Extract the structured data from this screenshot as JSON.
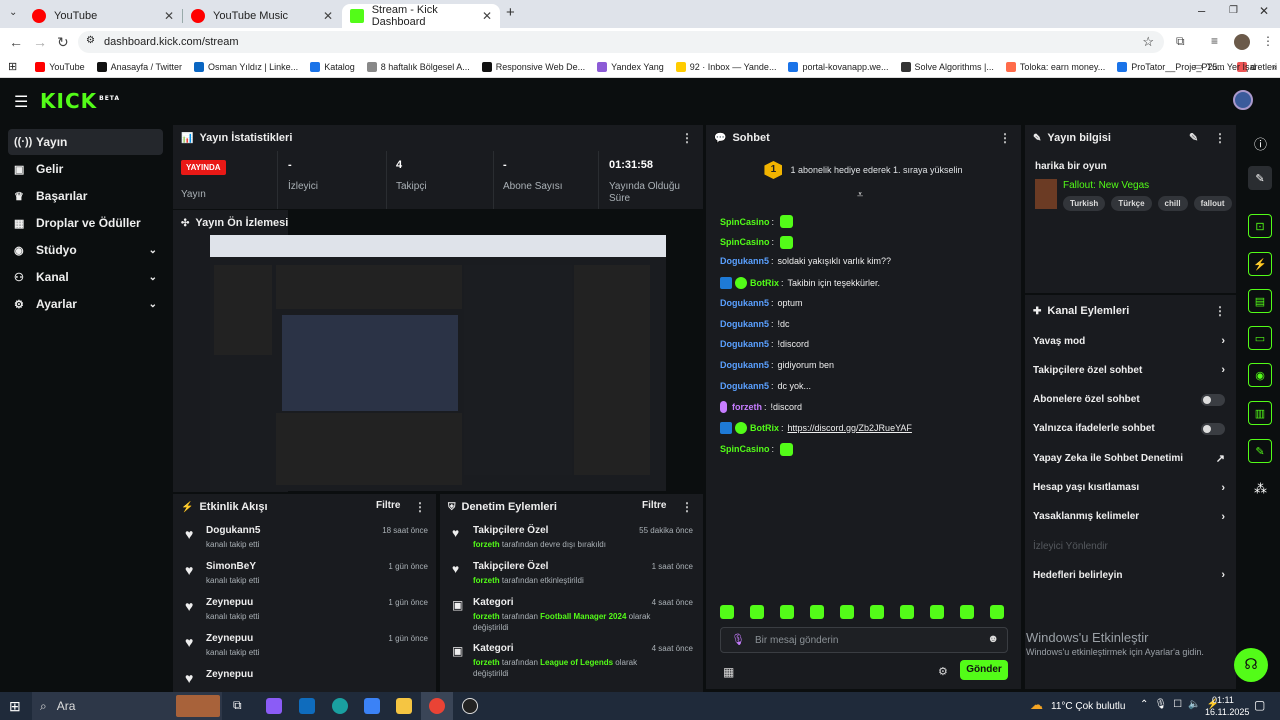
{
  "browser": {
    "tabs": [
      {
        "label": "YouTube",
        "color": "#ff0000"
      },
      {
        "label": "YouTube Music",
        "color": "#ff0000"
      },
      {
        "label": "Stream - Kick Dashboard",
        "color": "#53fc18"
      }
    ],
    "url": "dashboard.kick.com/stream",
    "bookmarks": [
      {
        "label": "YouTube",
        "color": "#ff0000"
      },
      {
        "label": "Anasayfa / Twitter",
        "color": "#111111"
      },
      {
        "label": "Osman Yıldız | Linke...",
        "color": "#0a66c2"
      },
      {
        "label": "Katalog",
        "color": "#1a73e8"
      },
      {
        "label": "8 haftalık Bölgesel A...",
        "color": "#888888"
      },
      {
        "label": "Responsive Web De...",
        "color": "#111111"
      },
      {
        "label": "Yandex Yang",
        "color": "#8c5bd6"
      },
      {
        "label": "92 · Inbox — Yande...",
        "color": "#ffcc00"
      },
      {
        "label": "portal-kovanapp.we...",
        "color": "#1a73e8"
      },
      {
        "label": "Solve Algorithms |...",
        "color": "#333333"
      },
      {
        "label": "Toloka: earn money...",
        "color": "#ff6b4a"
      },
      {
        "label": "ProTator__Proje_P25...",
        "color": "#1a73e8"
      },
      {
        "label": "d",
        "color": "#e55"
      }
    ],
    "all_bookmarks": "Tüm Yer İşaretleri"
  },
  "kick": {
    "logo": "KICK",
    "logo_sup": "BETA",
    "nav": [
      {
        "label": "Yayın",
        "icon": "stream-icon",
        "glyph": "((·))",
        "active": true,
        "chev": ""
      },
      {
        "label": "Gelir",
        "icon": "wallet-icon",
        "glyph": "▣",
        "active": false,
        "chev": ""
      },
      {
        "label": "Başarılar",
        "icon": "trophy-icon",
        "glyph": "♛",
        "active": false,
        "chev": ""
      },
      {
        "label": "Droplar ve Ödüller",
        "icon": "gift-icon",
        "glyph": "▦",
        "active": false,
        "chev": ""
      },
      {
        "label": "Stüdyo",
        "icon": "studio-icon",
        "glyph": "◉",
        "active": false,
        "chev": "⌄"
      },
      {
        "label": "Kanal",
        "icon": "channel-icon",
        "glyph": "⚇",
        "active": false,
        "chev": "⌄"
      },
      {
        "label": "Ayarlar",
        "icon": "settings-icon",
        "glyph": "⚙",
        "active": false,
        "chev": "⌄"
      }
    ]
  },
  "stats": {
    "title": "Yayın İstatistikleri",
    "live_badge": "YAYINDA",
    "live_label": "Yayın",
    "items": [
      {
        "value": "-",
        "label": "İzleyici"
      },
      {
        "value": "4",
        "label": "Takipçi"
      },
      {
        "value": "-",
        "label": "Abone Sayısı"
      },
      {
        "value": "01:31:58",
        "label": "Yayında Olduğu Süre"
      }
    ]
  },
  "preview": {
    "title": "Yayın Ön İzlemesi"
  },
  "events": {
    "title": "Etkinlik Akışı",
    "filter": "Filtre",
    "items": [
      {
        "name": "Dogukann5",
        "desc": "kanalı takip etti",
        "time": "18 saat önce"
      },
      {
        "name": "SimonBeY",
        "desc": "kanalı takip etti",
        "time": "1 gün önce"
      },
      {
        "name": "Zeynepuu",
        "desc": "kanalı takip etti",
        "time": "1 gün önce"
      },
      {
        "name": "Zeynepuu",
        "desc": "kanalı takip etti",
        "time": "1 gün önce"
      },
      {
        "name": "Zeynepuu",
        "desc": "",
        "time": ""
      }
    ]
  },
  "moderation": {
    "title": "Denetim Eylemleri",
    "filter": "Filtre",
    "items": [
      {
        "name": "Takipçilere Özel",
        "user": "forzeth",
        "pre": " tarafından devre dışı bırakıldı",
        "cat": "",
        "post": "",
        "time": "55 dakika önce",
        "icon": "heart-icon",
        "glyph": "♥"
      },
      {
        "name": "Takipçilere Özel",
        "user": "forzeth",
        "pre": " tarafından etkinleştirildi",
        "cat": "",
        "post": "",
        "time": "1 saat önce",
        "icon": "heart-icon",
        "glyph": "♥"
      },
      {
        "name": "Kategori",
        "user": "forzeth",
        "pre": " tarafından ",
        "cat": "Football Manager 2024",
        "post": " olarak değiştirildi",
        "time": "4 saat önce",
        "icon": "category-icon",
        "glyph": "▣"
      },
      {
        "name": "Kategori",
        "user": "forzeth",
        "pre": " tarafından ",
        "cat": "League of Legends",
        "post": " olarak değiştirildi",
        "time": "4 saat önce",
        "icon": "category-icon",
        "glyph": "▣"
      }
    ]
  },
  "chat": {
    "title": "Sohbet",
    "banner": "1 abonelik hediye ederek 1. sıraya yükselin",
    "banner_num": "1",
    "messages": [
      {
        "user": "SpinCasino",
        "text": "",
        "color": "#53fc18",
        "emote": true,
        "badges": 0
      },
      {
        "user": "SpinCasino",
        "text": "",
        "color": "#53fc18",
        "emote": true,
        "badges": 0
      },
      {
        "user": "Dogukann5",
        "text": "soldaki yakışıklı varlık kim??",
        "color": "#5aa0ff",
        "emote": false,
        "badges": 0
      },
      {
        "user": "BotRix",
        "text": "Takibin için teşekkürler.",
        "color": "#53fc18",
        "emote": false,
        "badges": 2
      },
      {
        "user": "Dogukann5",
        "text": "optum",
        "color": "#5aa0ff",
        "emote": false,
        "badges": 0
      },
      {
        "user": "Dogukann5",
        "text": "!dc",
        "color": "#5aa0ff",
        "emote": false,
        "badges": 0
      },
      {
        "user": "Dogukann5",
        "text": "!discord",
        "color": "#5aa0ff",
        "emote": false,
        "badges": 0
      },
      {
        "user": "Dogukann5",
        "text": "gidiyorum ben",
        "color": "#5aa0ff",
        "emote": false,
        "badges": 0
      },
      {
        "user": "Dogukann5",
        "text": "dc yok...",
        "color": "#5aa0ff",
        "emote": false,
        "badges": 0
      },
      {
        "user": "forzeth",
        "text": "!discord",
        "color": "#c77dff",
        "emote": false,
        "badges": 1
      },
      {
        "user": "BotRix",
        "text": "https://discord.gg/Zb2JRueYAF",
        "color": "#53fc18",
        "emote": false,
        "badges": 2
      },
      {
        "user": "SpinCasino",
        "text": "",
        "color": "#53fc18",
        "emote": true,
        "badges": 0
      }
    ],
    "placeholder": "Bir mesaj gönderin",
    "send": "Gönder"
  },
  "info": {
    "title": "Yayın bilgisi",
    "stream_title": "harika bir oyun",
    "game": "Fallout: New Vegas",
    "tags": [
      "Turkish",
      "Türkçe",
      "chill",
      "fallout"
    ]
  },
  "channel_actions": {
    "title": "Kanal Eylemleri",
    "items": [
      {
        "label": "Yavaş mod",
        "kind": "chevron",
        "mark": "›"
      },
      {
        "label": "Takipçilere özel sohbet",
        "kind": "chevron",
        "mark": "›"
      },
      {
        "label": "Abonelere özel sohbet",
        "kind": "toggle",
        "mark": ""
      },
      {
        "label": "Yalnızca ifadelerle sohbet",
        "kind": "toggle",
        "mark": ""
      },
      {
        "label": "Yapay Zeka ile Sohbet Denetimi",
        "kind": "external",
        "mark": "↗"
      },
      {
        "label": "Hesap yaşı kısıtlaması",
        "kind": "chevron",
        "mark": "›"
      },
      {
        "label": "Yasaklanmış kelimeler",
        "kind": "chevron",
        "mark": "›"
      },
      {
        "label": "İzleyici Yönlendir",
        "kind": "disabled",
        "mark": ""
      },
      {
        "label": "Hedefleri belirleyin",
        "kind": "chevron",
        "mark": "›"
      }
    ]
  },
  "watermark": {
    "line1": "Windows'u Etkinleştir",
    "line2": "Windows'u etkinleştirmek için Ayarlar'a gidin."
  },
  "taskbar": {
    "search": "Ara",
    "weather": "11°C  Çok bulutlu",
    "time": "01:11",
    "date": "16.11.2025"
  }
}
